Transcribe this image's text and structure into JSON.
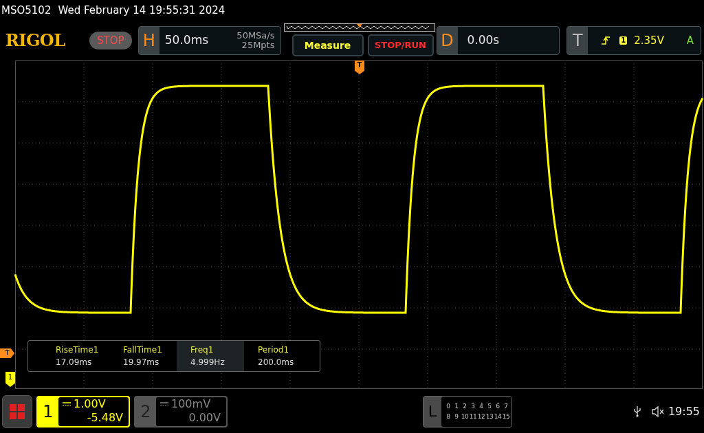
{
  "top_status": {
    "model": "MSO5102",
    "datetime": "Wed February 14 19:55:31 2024"
  },
  "header": {
    "logo": "RIGOL",
    "run_state": "STOP",
    "horizontal": {
      "label": "H",
      "timebase": "50.0ms",
      "sample_rate": "50MSa/s",
      "memory_depth": "25Mpts"
    },
    "measure_button": "Measure",
    "stop_run_button": "STOP/RUN",
    "delay": {
      "label": "D",
      "value": "0.00s"
    },
    "trigger": {
      "label": "T",
      "source": "1",
      "level": "2.35V",
      "mode": "A"
    }
  },
  "display": {
    "trigger_position_marker": "T",
    "trigger_level_marker": "T",
    "channel_marker": "1"
  },
  "measurements": [
    {
      "name": "RiseTime1",
      "value": "17.09ms",
      "selected": false
    },
    {
      "name": "FallTime1",
      "value": "19.97ms",
      "selected": false
    },
    {
      "name": "Freq1",
      "value": "4.999Hz",
      "selected": true
    },
    {
      "name": "Period1",
      "value": "200.0ms",
      "selected": false
    }
  ],
  "channels": [
    {
      "number": "1",
      "scale": "1.00V",
      "offset": "-5.48V",
      "active": true
    },
    {
      "number": "2",
      "scale": "100mV",
      "offset": "0.00V",
      "active": false
    }
  ],
  "logic": {
    "label": "L",
    "rows": [
      [
        "0",
        "1",
        "2",
        "3",
        "4",
        "5",
        "6",
        "7"
      ],
      [
        "8",
        "9",
        "10",
        "11",
        "12",
        "13",
        "14",
        "15"
      ]
    ]
  },
  "clock": "19:55"
}
